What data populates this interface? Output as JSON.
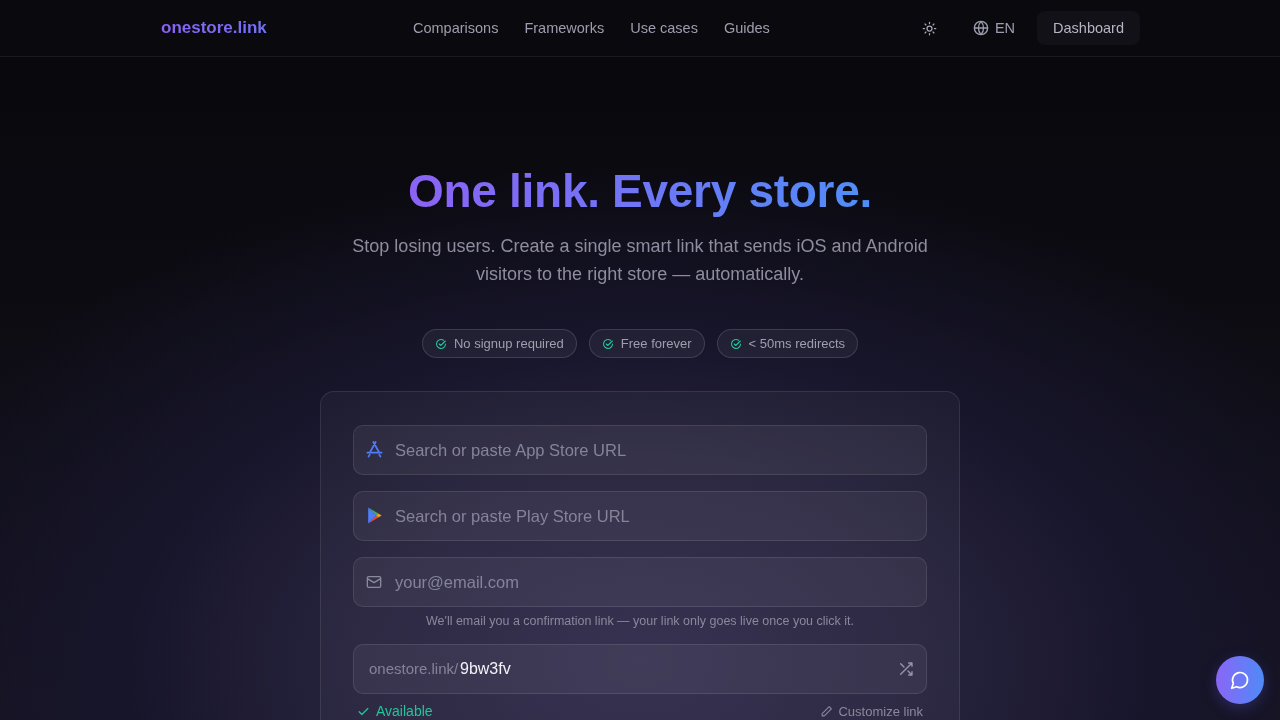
{
  "header": {
    "logo": "onestore.link",
    "nav": [
      "Comparisons",
      "Frameworks",
      "Use cases",
      "Guides"
    ],
    "language": "EN",
    "dashboard": "Dashboard"
  },
  "hero": {
    "title": "One link. Every store.",
    "subtitle": "Stop losing users. Create a single smart link that sends iOS and Android visitors to the right store — automatically.",
    "badges": [
      "No signup required",
      "Free forever",
      "< 50ms redirects"
    ]
  },
  "form": {
    "fields": [
      {
        "kind": "app_store",
        "placeholder": "Search or paste App Store URL"
      },
      {
        "kind": "play_store",
        "placeholder": "Search or paste Play Store URL"
      },
      {
        "kind": "email",
        "placeholder": "your@email.com"
      }
    ],
    "hint": "We'll email you a confirmation link — your link only goes live once you click it.",
    "slug": {
      "prefix": "onestore.link/",
      "value": "9bw3fv"
    },
    "available": true,
    "status": "Available",
    "customize": "Customize link"
  }
}
